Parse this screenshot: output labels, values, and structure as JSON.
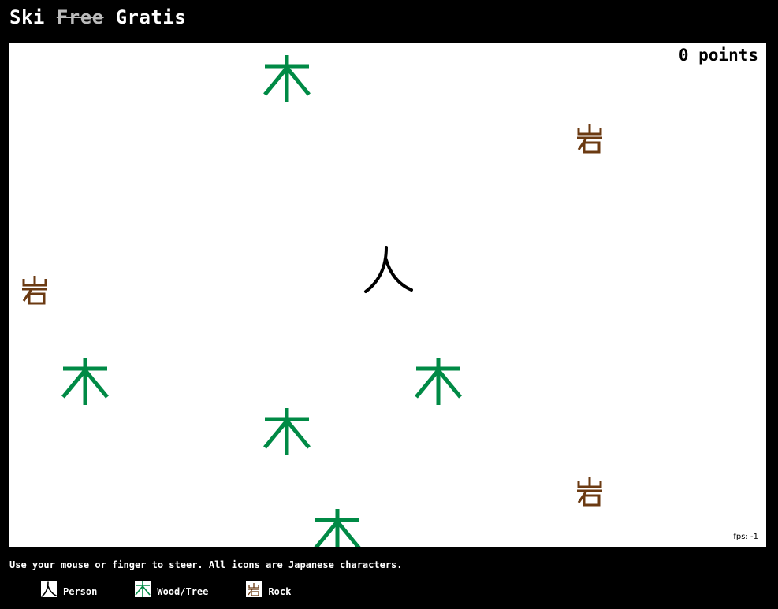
{
  "title": {
    "word1": "Ski",
    "word2_struck": "Free",
    "word3": "Gratis"
  },
  "game": {
    "score_value": "0",
    "score_unit": "points",
    "fps_label": "fps: -1"
  },
  "sprites": {
    "tree_char": "木",
    "rock_char": "岩",
    "person_char": "人",
    "tree_color": "#008a45",
    "rock_color": "#6b3a12",
    "person_color": "#000000"
  },
  "instructions": "Use your mouse or finger to steer. All icons are Japanese characters.",
  "legend": [
    {
      "icon": "person-glyph",
      "label": "Person"
    },
    {
      "icon": "tree-glyph",
      "label": "Wood/Tree"
    },
    {
      "icon": "rock-glyph",
      "label": "Rock"
    }
  ]
}
